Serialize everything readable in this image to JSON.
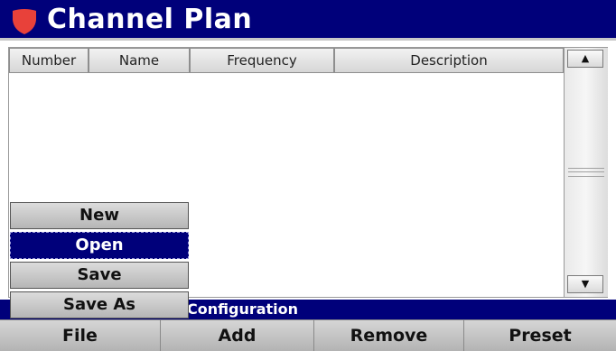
{
  "title": "Channel Plan",
  "table": {
    "columns": [
      "Number",
      "Name",
      "Frequency",
      "Description"
    ]
  },
  "scrollbar": {
    "up_icon": "▲",
    "down_icon": "▼"
  },
  "status": {
    "text": "Configuration"
  },
  "file_menu": {
    "items": [
      "New",
      "Open",
      "Save",
      "Save As"
    ],
    "selected": "Open"
  },
  "softkeys": [
    "File",
    "Add",
    "Remove",
    "Preset"
  ],
  "colors": {
    "title_bg": "#00007a",
    "logo": "#e8413a",
    "selected_bg": "#00007a"
  }
}
